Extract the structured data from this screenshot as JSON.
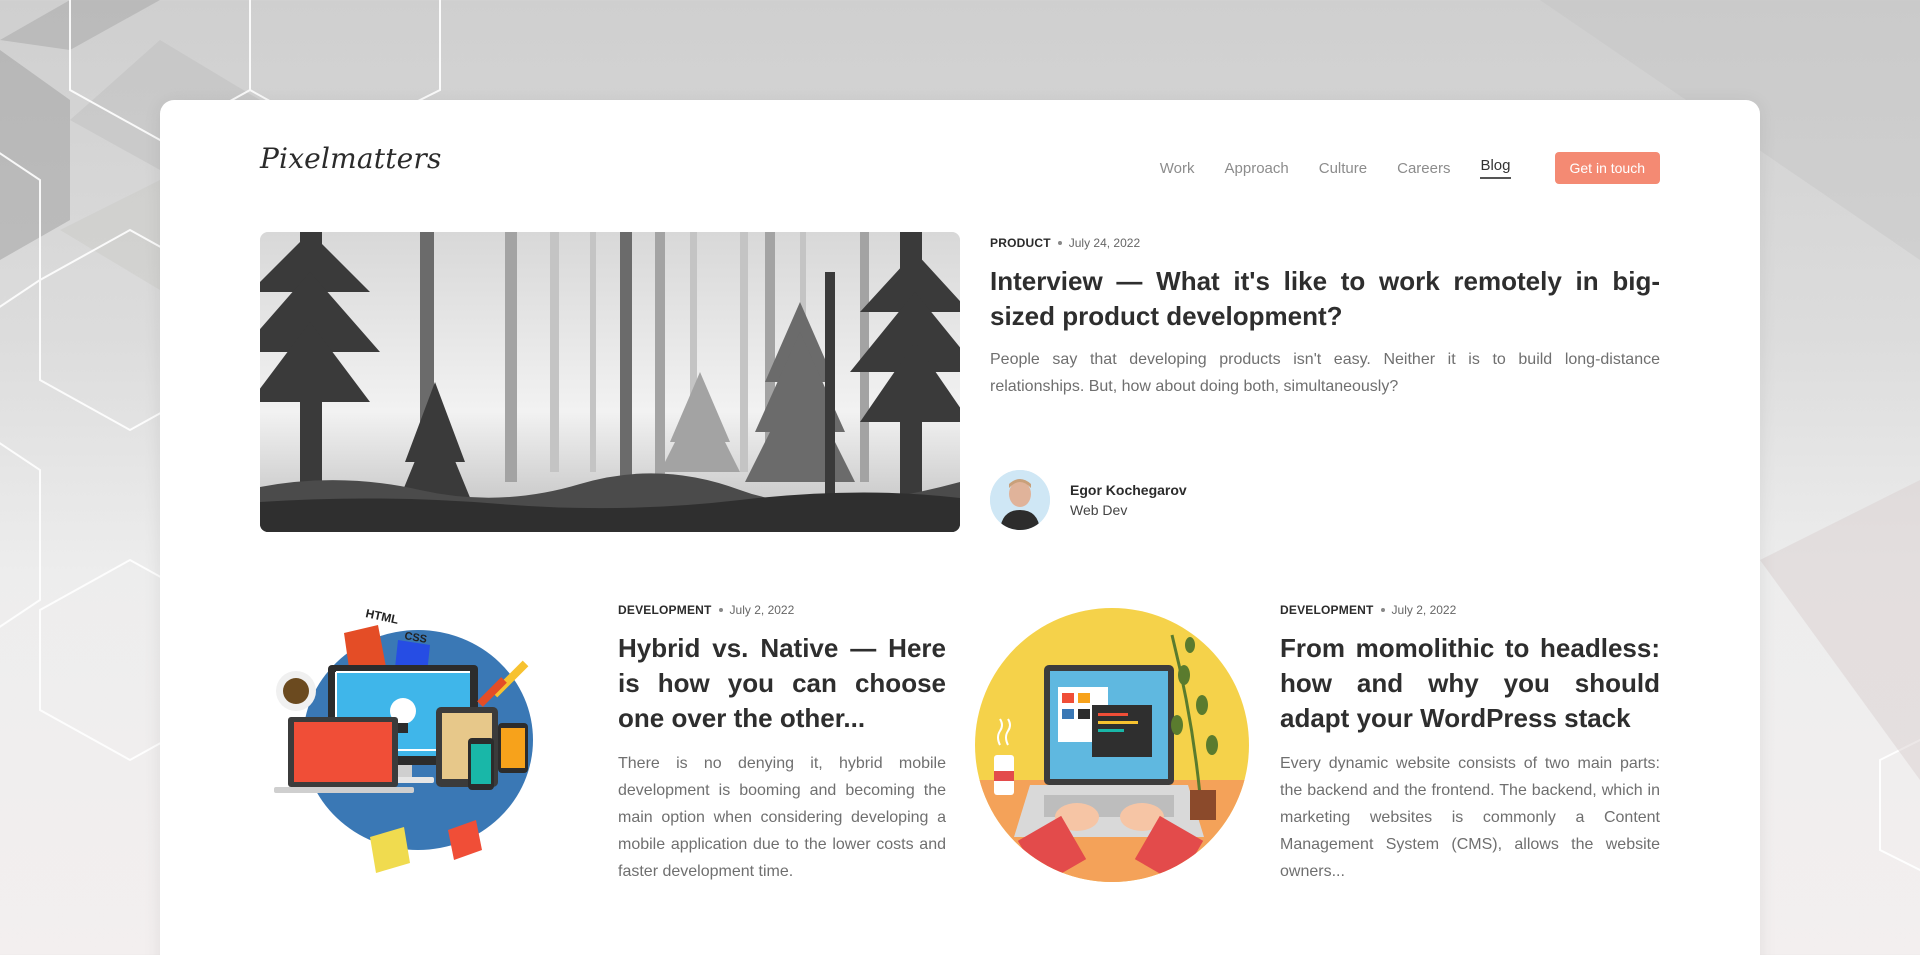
{
  "brand": {
    "logo_text": "Pixelmatters"
  },
  "nav": {
    "items": [
      {
        "label": "Work"
      },
      {
        "label": "Approach"
      },
      {
        "label": "Culture"
      },
      {
        "label": "Careers"
      },
      {
        "label": "Blog",
        "active": true
      }
    ],
    "cta_label": "Get in touch"
  },
  "colors": {
    "accent": "#f48a73",
    "text_dark": "#2e2e2e",
    "text_muted": "#6f6f6f"
  },
  "featured": {
    "category": "PRODUCT",
    "date": "July 24, 2022",
    "title": "Interview — What it's like to work remotely in big-sized product development?",
    "excerpt": "People say that developing products isn't easy. Neither it is to build long-distance relationships. But, how about doing both, simultaneously?",
    "image": "forest-illustration",
    "author": {
      "name": "Egor Kochegarov",
      "role": "Web Dev",
      "avatar": "author-avatar"
    }
  },
  "posts": [
    {
      "category": "DEVELOPMENT",
      "date": "July 2, 2022",
      "title": "Hybrid vs. Native — Here is how you can choose one over the other...",
      "excerpt": "There is no denying it, hybrid mobile development is booming and becoming the main option when considering developing a mobile application due to the lower costs and faster development time.",
      "image": "devices-illustration",
      "badges": [
        "HTML",
        "CSS"
      ]
    },
    {
      "category": "DEVELOPMENT",
      "date": "July 2, 2022",
      "title": "From momolithic to headless: how and why you should adapt your WordPress stack",
      "excerpt": "Every dynamic website consists of two main parts: the backend and the frontend. The backend, which in marketing websites is commonly a Content Management System (CMS), allows the website owners...",
      "image": "laptop-illustration"
    }
  ]
}
